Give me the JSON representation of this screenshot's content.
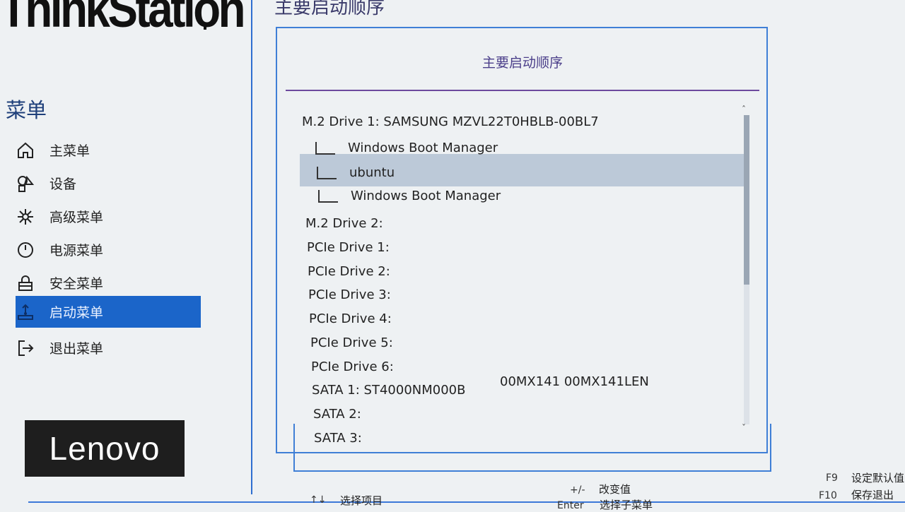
{
  "brand": {
    "name": "ThinkStation"
  },
  "sidebar": {
    "title": "菜单",
    "items": [
      {
        "label": "主菜单",
        "icon": "home-icon"
      },
      {
        "label": "设备",
        "icon": "devices-icon"
      },
      {
        "label": "高级菜单",
        "icon": "advanced-icon"
      },
      {
        "label": "电源菜单",
        "icon": "power-icon"
      },
      {
        "label": "安全菜单",
        "icon": "lock-icon"
      },
      {
        "label": "启动菜单",
        "icon": "startup-icon",
        "active": true
      },
      {
        "label": "退出菜单",
        "icon": "exit-icon"
      }
    ]
  },
  "vendor_logo": "Lenovo",
  "page": {
    "title": "主要启动顺序",
    "panel_title": "主要启动顺序"
  },
  "boot_list": [
    {
      "label": "M.2 Drive 1: SAMSUNG MZVL22T0HBLB-00BL7",
      "level": 0
    },
    {
      "label": "Windows Boot Manager",
      "level": 1
    },
    {
      "label": "ubuntu",
      "level": 1,
      "selected": true
    },
    {
      "label": "Windows Boot Manager",
      "level": 1
    },
    {
      "label": "M.2 Drive 2:",
      "level": 0
    },
    {
      "label": "PCIe Drive 1:",
      "level": 0
    },
    {
      "label": "PCIe Drive 2:",
      "level": 0
    },
    {
      "label": "PCIe Drive 3:",
      "level": 0
    },
    {
      "label": "PCIe Drive 4:",
      "level": 0
    },
    {
      "label": "PCIe Drive 5:",
      "level": 0
    },
    {
      "label": "PCIe Drive 6:",
      "level": 0
    },
    {
      "label": "SATA 1: ST4000NM000B",
      "level": 0,
      "model": "00MX141 00MX141LEN"
    },
    {
      "label": "SATA 2:",
      "level": 0
    },
    {
      "label": "SATA 3:",
      "level": 0
    }
  ],
  "footer": {
    "select_item": {
      "key": "↑↓",
      "desc": "选择项目"
    },
    "change_value": {
      "key": "+/-",
      "desc": "改变值"
    },
    "enter_submenu": {
      "key": "Enter",
      "desc": "选择子菜单"
    },
    "f9": {
      "key": "F9",
      "desc": "设定默认值"
    },
    "f10": {
      "key": "F10",
      "desc": "保存退出"
    }
  },
  "colors": {
    "accent": "#1b65c9",
    "panel_border": "#3f7fd6",
    "selection": "#bcc9d8",
    "title_rule": "#6d4a9e"
  }
}
